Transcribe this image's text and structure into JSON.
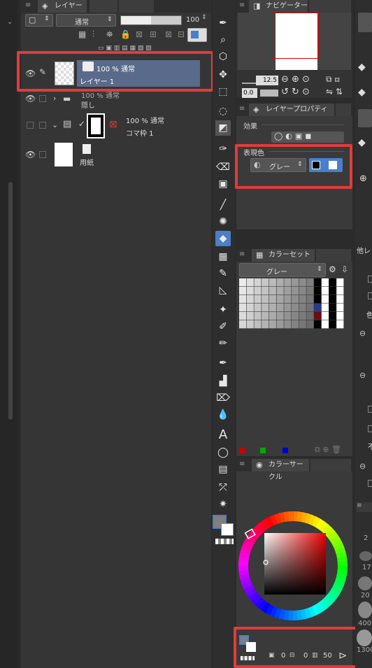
{
  "layer_panel": {
    "tab_label": "レイヤー",
    "blend_mode": "通常",
    "opacity": "100",
    "layers": [
      {
        "line1": "100 % 通常",
        "line2": "レイヤー 1"
      },
      {
        "line1": "100 % 通常",
        "line2": "隠し"
      },
      {
        "line1": "100 % 通常",
        "line2": "コマ枠 1"
      },
      {
        "line1": "",
        "line2": "用紙"
      }
    ]
  },
  "navigator": {
    "tab_label": "ナビゲーター",
    "zoom": "12.5",
    "rotation": "0.0"
  },
  "layer_property": {
    "tab_label": "レイヤープロパティ",
    "effect_label": "効果",
    "expression_label": "表現色",
    "expression_value": "グレー"
  },
  "color_set": {
    "tab_label": "カラーセット",
    "set_name": "グレー"
  },
  "color_wheel": {
    "tab_label": "カラーサークル",
    "h_value": "0",
    "s_value": "0",
    "v_value": "50"
  },
  "right_strip": {
    "label1": "他レ",
    "label2": "色",
    "label3": "不",
    "num1": "2",
    "num2": "17",
    "num3": "20",
    "num4": "400",
    "num5": "1300"
  },
  "colors": {
    "highlight_red": "#e23b3b",
    "selected_layer": "#5a6a8a",
    "accent_blue": "#4a7fc9"
  }
}
